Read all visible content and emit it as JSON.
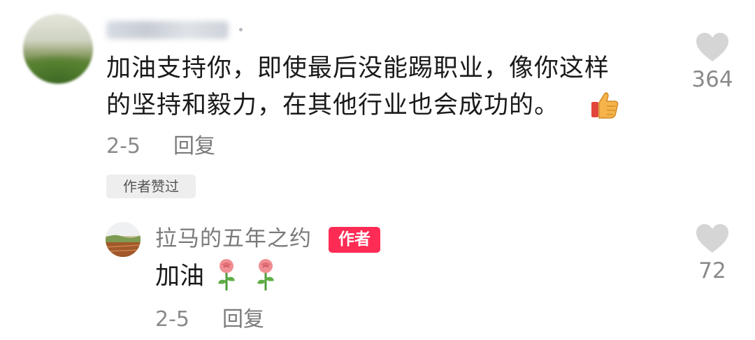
{
  "comment": {
    "line1": "加油支持你，即使最后没能踢职业，像你这样",
    "line2": "的坚持和毅力，在其他行业也会成功的。",
    "thumbs_emoji": "thumbs-up",
    "date": "2-5",
    "reply_label": "回复",
    "likes": "364",
    "author_liked": "作者赞过"
  },
  "reply": {
    "username": "拉马的五年之约",
    "author_badge": "作者",
    "text": "加油",
    "emojis": [
      "rose",
      "rose"
    ],
    "date": "2-5",
    "reply_label": "回复",
    "likes": "72"
  },
  "colors": {
    "text": "#1a1a1a",
    "meta": "#8a8a8a",
    "badge": "#fe2c55",
    "like_icon": "#d5d5d5"
  }
}
